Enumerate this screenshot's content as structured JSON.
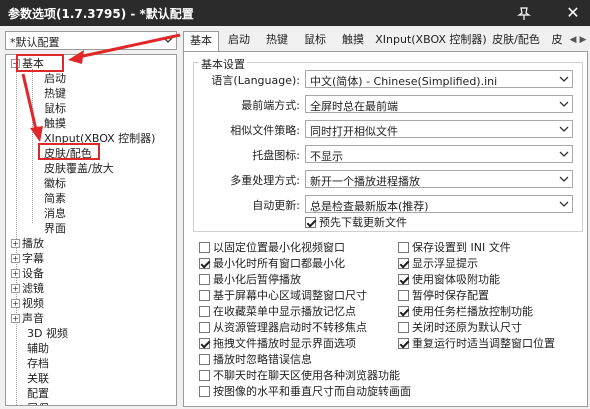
{
  "window": {
    "title": "参数选项(1.7.3795) - *默认配置"
  },
  "profile": {
    "selected": "*默认配置"
  },
  "tree": {
    "nodes": [
      {
        "label": "基本",
        "expander": "−"
      },
      {
        "label": "启动"
      },
      {
        "label": "热键"
      },
      {
        "label": "鼠标"
      },
      {
        "label": "触摸"
      },
      {
        "label": "XInput(XBOX 控制器)"
      },
      {
        "label": "皮肤/配色"
      },
      {
        "label": "皮肤覆盖/放大"
      },
      {
        "label": "徽标"
      },
      {
        "label": "简素"
      },
      {
        "label": "消息"
      },
      {
        "label": "界面"
      },
      {
        "label": "播放",
        "expander": "+"
      },
      {
        "label": "字幕",
        "expander": "+"
      },
      {
        "label": "设备",
        "expander": "+"
      },
      {
        "label": "滤镜",
        "expander": "+"
      },
      {
        "label": "视频",
        "expander": "+"
      },
      {
        "label": "声音",
        "expander": "+"
      },
      {
        "label": "3D 视频"
      },
      {
        "label": "辅助"
      },
      {
        "label": "存档"
      },
      {
        "label": "关联"
      },
      {
        "label": "配置"
      },
      {
        "label": "屏保"
      }
    ]
  },
  "tabs": [
    "基本",
    "启动",
    "热键",
    "鼠标",
    "触摸",
    "XInput(XBOX 控制器)",
    "皮肤/配色",
    "皮"
  ],
  "tab_scroll": {
    "left": "◀",
    "right": "▶"
  },
  "settings": {
    "group_title": "基本设置",
    "rows": [
      {
        "label": "语言(Language):",
        "value": "中文(简体) - Chinese(Simplified).ini"
      },
      {
        "label": "最前端方式:",
        "value": "全屏时总在最前端"
      },
      {
        "label": "相似文件策略:",
        "value": "同时打开相似文件"
      },
      {
        "label": "托盘图标:",
        "value": "不显示"
      },
      {
        "label": "多重处理方式:",
        "value": "新开一个播放进程播放"
      },
      {
        "label": "自动更新:",
        "value": "总是检查最新版本(推荐)"
      }
    ],
    "predownload": {
      "label": "预先下载更新文件",
      "checked": true
    }
  },
  "options_left": [
    {
      "label": "以固定位置最小化视频窗口",
      "checked": false
    },
    {
      "label": "最小化时所有窗口都最小化",
      "checked": true
    },
    {
      "label": "最小化后暂停播放",
      "checked": false
    },
    {
      "label": "基于屏幕中心区域调整窗口尺寸",
      "checked": false
    },
    {
      "label": "在收藏菜单中显示播放记忆点",
      "checked": false
    },
    {
      "label": "从资源管理器启动时不转移焦点",
      "checked": false
    },
    {
      "label": "拖拽文件播放时显示界面选项",
      "checked": true
    },
    {
      "label": "播放时忽略错误信息",
      "checked": false
    },
    {
      "label": "不聊天时在聊天区使用各种浏览器功能",
      "checked": false
    },
    {
      "label": "按图像的水平和垂直尺寸而自动旋转画面",
      "checked": false
    }
  ],
  "options_right": [
    {
      "label": "保存设置到 INI 文件",
      "checked": false
    },
    {
      "label": "显示浮显提示",
      "checked": true
    },
    {
      "label": "使用窗体吸附功能",
      "checked": true
    },
    {
      "label": "暂停时保存配置",
      "checked": false
    },
    {
      "label": "使用任务栏播放控制功能",
      "checked": true
    },
    {
      "label": "关闭时还原为默认尺寸",
      "checked": false
    },
    {
      "label": "重复运行时适当调整窗口位置",
      "checked": true
    }
  ],
  "colors": {
    "titlebar": "#2b2b2b",
    "annotation": "#e0272a"
  }
}
